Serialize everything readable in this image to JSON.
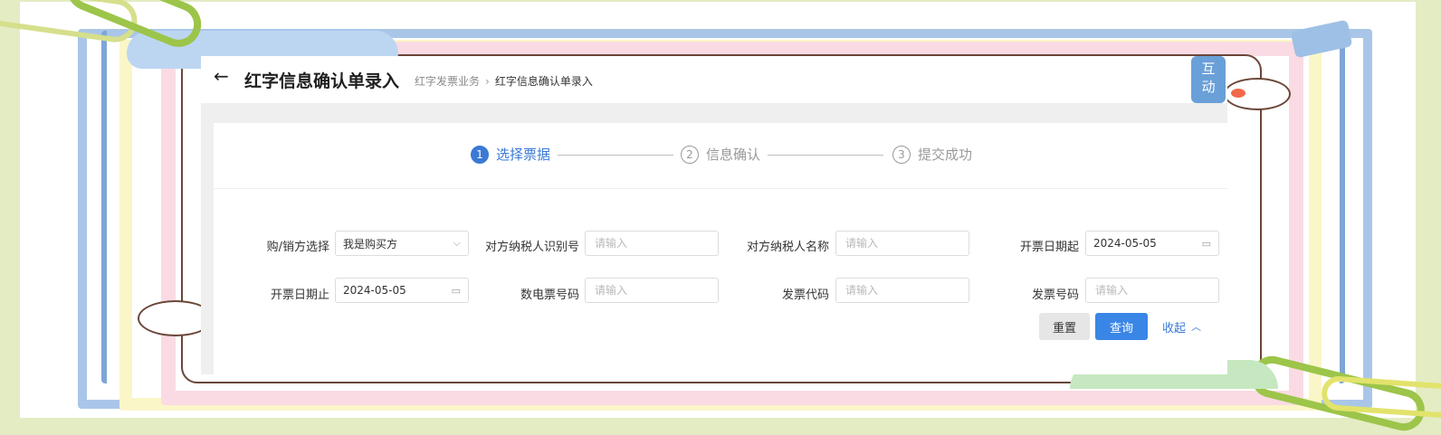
{
  "decor": {
    "badge_line1": "互",
    "badge_line2": "动"
  },
  "header": {
    "back_icon": "arrow-left-icon",
    "title": "红字信息确认单录入",
    "breadcrumb": [
      "红字发票业务",
      "红字信息确认单录入"
    ],
    "breadcrumb_sep": "›"
  },
  "steps": [
    {
      "num": "1",
      "label": "选择票据",
      "active": true
    },
    {
      "num": "2",
      "label": "信息确认",
      "active": false
    },
    {
      "num": "3",
      "label": "提交成功",
      "active": false
    }
  ],
  "form": {
    "buyer_seller": {
      "label": "购/销方选择",
      "value": "我是购买方",
      "icon": "chevron-down-icon"
    },
    "counterparty_tax_id": {
      "label": "对方纳税人识别号",
      "placeholder": "请输入"
    },
    "counterparty_name": {
      "label": "对方纳税人名称",
      "placeholder": "请输入"
    },
    "date_start": {
      "label": "开票日期起",
      "value": "2024-05-05",
      "icon": "calendar-icon"
    },
    "date_end": {
      "label": "开票日期止",
      "value": "2024-05-05",
      "icon": "calendar-icon"
    },
    "e_invoice_no": {
      "label": "数电票号码",
      "placeholder": "请输入"
    },
    "invoice_code": {
      "label": "发票代码",
      "placeholder": "请输入"
    },
    "invoice_no": {
      "label": "发票号码",
      "placeholder": "请输入"
    }
  },
  "actions": {
    "reset": "重置",
    "query": "查询",
    "collapse": "收起",
    "collapse_icon": "chevron-up-icon"
  },
  "colors": {
    "primary": "#3a86e6",
    "active_step": "#3a79d6",
    "page_bg": "#e4ecc4"
  }
}
